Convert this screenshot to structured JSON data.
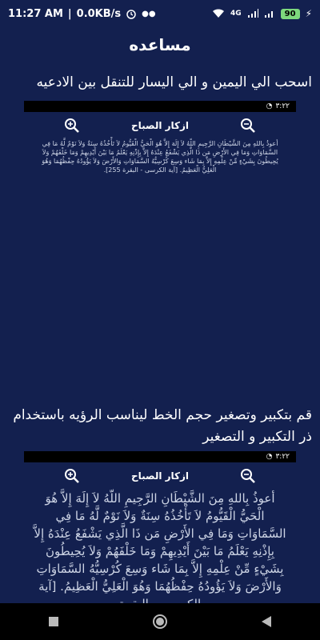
{
  "status": {
    "time": "11:27 AM",
    "speed": "0.0KB/s",
    "network": "4G",
    "battery": "90"
  },
  "title": "مساعده",
  "instr1": "اسحب الي اليمين و الي اليسار للتنقل بين الادعيه",
  "instr2": "قم بتكبير وتصغير حجم الخط ليناسب الرؤيه باستخدام ذر التكبير و التصغير",
  "mini": {
    "status_time": "٣:٢٢",
    "header_title": "ازكار الصباح",
    "prayer_small": "أعوذُ بِاللهِ مِنَ الشَّيْطَانِ الرَّجِيمِ اللّهُ لاَ إِلَهَ إِلاَّ هُوَ الْحَيُّ الْقَيُّومُ لاَ تَأْخُذُهُ سِنَةٌ وَلاَ نَوْمٌ لَّهُ مَا فِي السَّمَاوَاتِ وَمَا فِي الأَرْضِ مَن ذَا الَّذِي يَشْفَعُ عِنْدَهُ إِلاَّ بِإِذْنِهِ يَعْلَمُ مَا بَيْنَ أَيْدِيهِمْ وَمَا خَلْفَهُمْ وَلاَ يُحِيطُونَ بِشَيْءٍ مِّنْ عِلْمِهِ إِلاَّ بِمَا شَاء وَسِعَ كُرْسِيُّهُ السَّمَاوَاتِ وَالأَرْضَ وَلاَ يَؤُودُهُ حِفْظُهُمَا وَهُوَ الْعَلِيُّ الْعَظِيمُ. [آية الكرسى - البقرة 255].",
    "prayer_large": "أعوذُ بِاللهِ مِنَ الشَّيْطَانِ الرَّجِيمِ اللّهُ لاَ إِلَهَ إِلاَّ هُوَ الْحَيُّ الْقَيُّومُ لاَ تَأْخُذُهُ سِنَةٌ وَلاَ نَوْمٌ لَّهُ مَا فِي السَّمَاوَاتِ وَمَا فِي الأَرْضِ مَن ذَا الَّذِي يَشْفَعُ عِنْدَهُ إِلاَّ بِإِذْنِهِ يَعْلَمُ مَا بَيْنَ أَيْدِيهِمْ وَمَا خَلْفَهُمْ وَلاَ يُحِيطُونَ بِشَيْءٍ مِّنْ عِلْمِهِ إِلاَّ بِمَا شَاء وَسِعَ كُرْسِيُّهُ السَّمَاوَاتِ وَالأَرْضَ وَلاَ يَؤُودُهُ حِفْظُهُمَا وَهُوَ الْعَلِيُّ الْعَظِيمُ. [آية الكرسى - البقرة"
  }
}
